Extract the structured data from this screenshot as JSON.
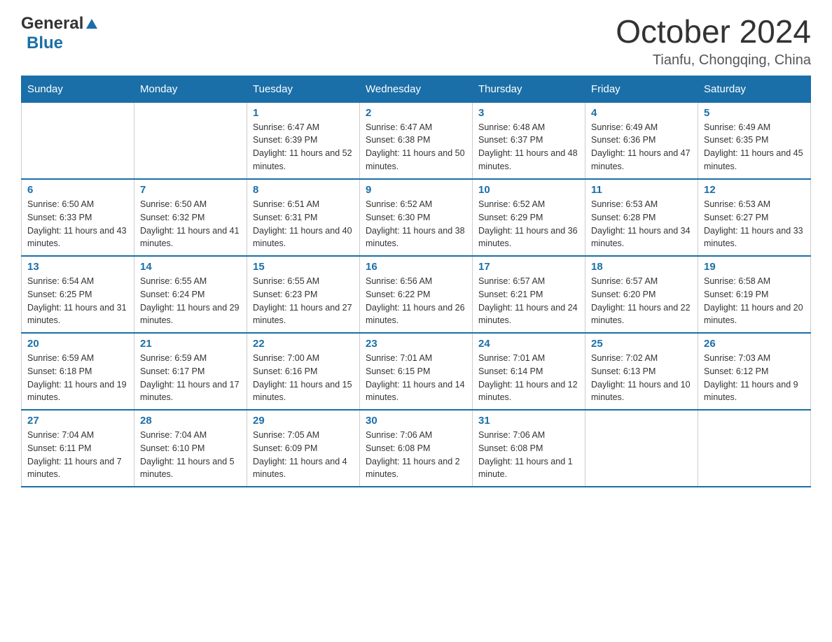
{
  "header": {
    "logo_general": "General",
    "logo_triangle": "▶",
    "logo_blue": "Blue",
    "main_title": "October 2024",
    "subtitle": "Tianfu, Chongqing, China"
  },
  "days_of_week": [
    "Sunday",
    "Monday",
    "Tuesday",
    "Wednesday",
    "Thursday",
    "Friday",
    "Saturday"
  ],
  "weeks": [
    [
      {
        "day": "",
        "sunrise": "",
        "sunset": "",
        "daylight": ""
      },
      {
        "day": "",
        "sunrise": "",
        "sunset": "",
        "daylight": ""
      },
      {
        "day": "1",
        "sunrise": "Sunrise: 6:47 AM",
        "sunset": "Sunset: 6:39 PM",
        "daylight": "Daylight: 11 hours and 52 minutes."
      },
      {
        "day": "2",
        "sunrise": "Sunrise: 6:47 AM",
        "sunset": "Sunset: 6:38 PM",
        "daylight": "Daylight: 11 hours and 50 minutes."
      },
      {
        "day": "3",
        "sunrise": "Sunrise: 6:48 AM",
        "sunset": "Sunset: 6:37 PM",
        "daylight": "Daylight: 11 hours and 48 minutes."
      },
      {
        "day": "4",
        "sunrise": "Sunrise: 6:49 AM",
        "sunset": "Sunset: 6:36 PM",
        "daylight": "Daylight: 11 hours and 47 minutes."
      },
      {
        "day": "5",
        "sunrise": "Sunrise: 6:49 AM",
        "sunset": "Sunset: 6:35 PM",
        "daylight": "Daylight: 11 hours and 45 minutes."
      }
    ],
    [
      {
        "day": "6",
        "sunrise": "Sunrise: 6:50 AM",
        "sunset": "Sunset: 6:33 PM",
        "daylight": "Daylight: 11 hours and 43 minutes."
      },
      {
        "day": "7",
        "sunrise": "Sunrise: 6:50 AM",
        "sunset": "Sunset: 6:32 PM",
        "daylight": "Daylight: 11 hours and 41 minutes."
      },
      {
        "day": "8",
        "sunrise": "Sunrise: 6:51 AM",
        "sunset": "Sunset: 6:31 PM",
        "daylight": "Daylight: 11 hours and 40 minutes."
      },
      {
        "day": "9",
        "sunrise": "Sunrise: 6:52 AM",
        "sunset": "Sunset: 6:30 PM",
        "daylight": "Daylight: 11 hours and 38 minutes."
      },
      {
        "day": "10",
        "sunrise": "Sunrise: 6:52 AM",
        "sunset": "Sunset: 6:29 PM",
        "daylight": "Daylight: 11 hours and 36 minutes."
      },
      {
        "day": "11",
        "sunrise": "Sunrise: 6:53 AM",
        "sunset": "Sunset: 6:28 PM",
        "daylight": "Daylight: 11 hours and 34 minutes."
      },
      {
        "day": "12",
        "sunrise": "Sunrise: 6:53 AM",
        "sunset": "Sunset: 6:27 PM",
        "daylight": "Daylight: 11 hours and 33 minutes."
      }
    ],
    [
      {
        "day": "13",
        "sunrise": "Sunrise: 6:54 AM",
        "sunset": "Sunset: 6:25 PM",
        "daylight": "Daylight: 11 hours and 31 minutes."
      },
      {
        "day": "14",
        "sunrise": "Sunrise: 6:55 AM",
        "sunset": "Sunset: 6:24 PM",
        "daylight": "Daylight: 11 hours and 29 minutes."
      },
      {
        "day": "15",
        "sunrise": "Sunrise: 6:55 AM",
        "sunset": "Sunset: 6:23 PM",
        "daylight": "Daylight: 11 hours and 27 minutes."
      },
      {
        "day": "16",
        "sunrise": "Sunrise: 6:56 AM",
        "sunset": "Sunset: 6:22 PM",
        "daylight": "Daylight: 11 hours and 26 minutes."
      },
      {
        "day": "17",
        "sunrise": "Sunrise: 6:57 AM",
        "sunset": "Sunset: 6:21 PM",
        "daylight": "Daylight: 11 hours and 24 minutes."
      },
      {
        "day": "18",
        "sunrise": "Sunrise: 6:57 AM",
        "sunset": "Sunset: 6:20 PM",
        "daylight": "Daylight: 11 hours and 22 minutes."
      },
      {
        "day": "19",
        "sunrise": "Sunrise: 6:58 AM",
        "sunset": "Sunset: 6:19 PM",
        "daylight": "Daylight: 11 hours and 20 minutes."
      }
    ],
    [
      {
        "day": "20",
        "sunrise": "Sunrise: 6:59 AM",
        "sunset": "Sunset: 6:18 PM",
        "daylight": "Daylight: 11 hours and 19 minutes."
      },
      {
        "day": "21",
        "sunrise": "Sunrise: 6:59 AM",
        "sunset": "Sunset: 6:17 PM",
        "daylight": "Daylight: 11 hours and 17 minutes."
      },
      {
        "day": "22",
        "sunrise": "Sunrise: 7:00 AM",
        "sunset": "Sunset: 6:16 PM",
        "daylight": "Daylight: 11 hours and 15 minutes."
      },
      {
        "day": "23",
        "sunrise": "Sunrise: 7:01 AM",
        "sunset": "Sunset: 6:15 PM",
        "daylight": "Daylight: 11 hours and 14 minutes."
      },
      {
        "day": "24",
        "sunrise": "Sunrise: 7:01 AM",
        "sunset": "Sunset: 6:14 PM",
        "daylight": "Daylight: 11 hours and 12 minutes."
      },
      {
        "day": "25",
        "sunrise": "Sunrise: 7:02 AM",
        "sunset": "Sunset: 6:13 PM",
        "daylight": "Daylight: 11 hours and 10 minutes."
      },
      {
        "day": "26",
        "sunrise": "Sunrise: 7:03 AM",
        "sunset": "Sunset: 6:12 PM",
        "daylight": "Daylight: 11 hours and 9 minutes."
      }
    ],
    [
      {
        "day": "27",
        "sunrise": "Sunrise: 7:04 AM",
        "sunset": "Sunset: 6:11 PM",
        "daylight": "Daylight: 11 hours and 7 minutes."
      },
      {
        "day": "28",
        "sunrise": "Sunrise: 7:04 AM",
        "sunset": "Sunset: 6:10 PM",
        "daylight": "Daylight: 11 hours and 5 minutes."
      },
      {
        "day": "29",
        "sunrise": "Sunrise: 7:05 AM",
        "sunset": "Sunset: 6:09 PM",
        "daylight": "Daylight: 11 hours and 4 minutes."
      },
      {
        "day": "30",
        "sunrise": "Sunrise: 7:06 AM",
        "sunset": "Sunset: 6:08 PM",
        "daylight": "Daylight: 11 hours and 2 minutes."
      },
      {
        "day": "31",
        "sunrise": "Sunrise: 7:06 AM",
        "sunset": "Sunset: 6:08 PM",
        "daylight": "Daylight: 11 hours and 1 minute."
      },
      {
        "day": "",
        "sunrise": "",
        "sunset": "",
        "daylight": ""
      },
      {
        "day": "",
        "sunrise": "",
        "sunset": "",
        "daylight": ""
      }
    ]
  ]
}
